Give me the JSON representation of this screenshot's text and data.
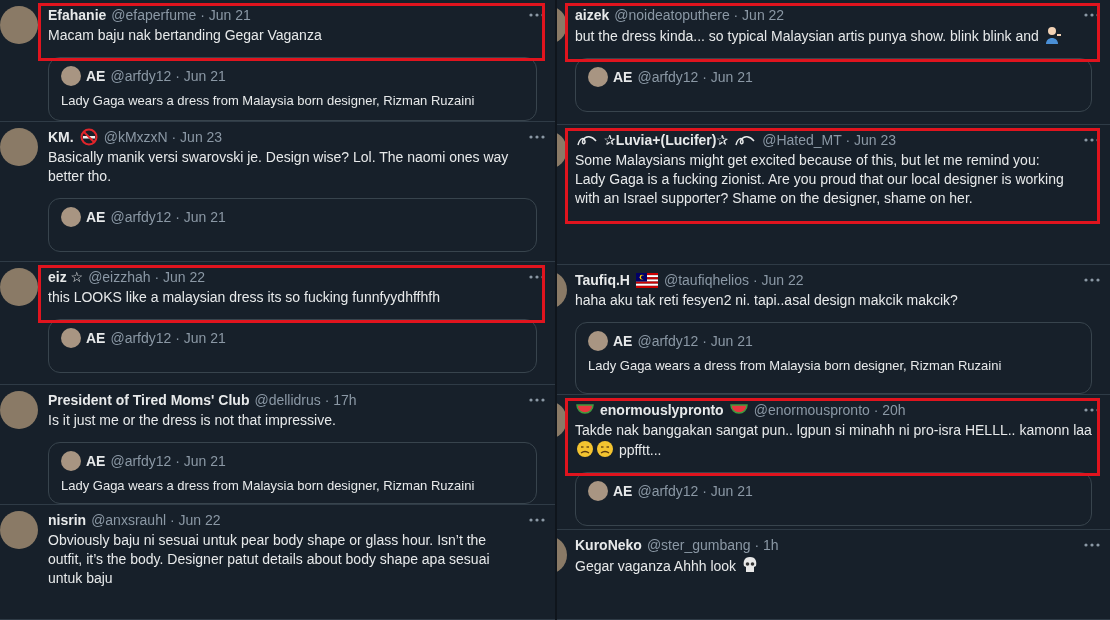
{
  "columns": [
    {
      "tweets": [
        {
          "name": [
            {
              "kind": "text",
              "text": "Efahanie"
            }
          ],
          "meta": "@efaperfume · Jun 21",
          "body": [
            {
              "kind": "text",
              "text": "Macam baju nak bertanding Gegar Vaganza"
            }
          ],
          "highlighted": true,
          "quote": {
            "name": "AE",
            "meta": "@arfdy12 · Jun 21",
            "text": "Lady Gaga wears a dress from Malaysia born designer, Rizman Ruzaini"
          }
        },
        {
          "name": [
            {
              "kind": "text",
              "text": "KM."
            },
            {
              "kind": "nosmoke"
            }
          ],
          "meta": "@kMxzxN · Jun 23",
          "body": [
            {
              "kind": "text",
              "text": "Basically manik versi swarovski je. Design wise? Lol. The naomi ones way better tho."
            }
          ],
          "highlighted": false,
          "quote": {
            "name": "AE",
            "meta": "@arfdy12 · Jun 21"
          }
        },
        {
          "name": [
            {
              "kind": "text",
              "text": "eiz ☆"
            }
          ],
          "meta": "@eizzhah · Jun 22",
          "body": [
            {
              "kind": "text",
              "text": "this LOOKS like a malaysian dress its so fucking funnfyydhffhfh"
            }
          ],
          "highlighted": true,
          "quote": {
            "name": "AE",
            "meta": "@arfdy12 · Jun 21"
          }
        },
        {
          "name": [
            {
              "kind": "text",
              "text": "President of Tired Moms' Club"
            }
          ],
          "meta": "@dellidrus · 17h",
          "body": [
            {
              "kind": "text",
              "text": "Is it just me or the dress is not that impressive."
            }
          ],
          "highlighted": false,
          "quote": {
            "name": "AE",
            "meta": "@arfdy12 · Jun 21",
            "text": "Lady Gaga wears a dress from Malaysia born designer, Rizman Ruzaini"
          }
        },
        {
          "name": [
            {
              "kind": "text",
              "text": "nisrin"
            }
          ],
          "meta": "@anxsrauhl · Jun 22",
          "body": [
            {
              "kind": "text",
              "text": "Obviously baju ni sesuai untuk pear body shape or glass hour. Isn’t the outfit, it’s the body. Designer patut details about body shape apa sesuai untuk baju"
            }
          ],
          "highlighted": false
        }
      ]
    },
    {
      "tweets": [
        {
          "name": [
            {
              "kind": "text",
              "text": "aizek"
            }
          ],
          "meta": "@noideatoputhere · Jun 22",
          "body": [
            {
              "kind": "text",
              "text": "but the dress kinda... so typical Malaysian artis punya show. blink blink and"
            },
            {
              "kind": "person"
            }
          ],
          "highlighted": true,
          "quote": {
            "name": "AE",
            "meta": "@arfdy12 · Jun 21"
          }
        },
        {
          "name": [
            {
              "kind": "swirl"
            },
            {
              "kind": "text",
              "text": "✰Luvia+(Lucifer)✰"
            },
            {
              "kind": "swirl"
            }
          ],
          "meta": "@Hated_MT · Jun 23",
          "body": [
            {
              "kind": "text",
              "text": "Some Malaysians might get excited because of this, but let me remind you: Lady Gaga is a fucking zionist. Are you proud that our local designer is working with an Israel supporter? Shame on the designer, shame on her."
            }
          ],
          "highlighted": true
        },
        {
          "name": [
            {
              "kind": "text",
              "text": "Taufiq.H"
            },
            {
              "kind": "flag"
            }
          ],
          "meta": "@taufiqhelios · Jun 22",
          "body": [
            {
              "kind": "text",
              "text": "haha aku tak reti fesyen2 ni. tapi..asal design makcik makcik?"
            }
          ],
          "highlighted": false,
          "quote": {
            "name": "AE",
            "meta": "@arfdy12 · Jun 21",
            "text": "Lady Gaga wears a dress from Malaysia born designer, Rizman Ruzaini"
          }
        },
        {
          "name": [
            {
              "kind": "melon"
            },
            {
              "kind": "text",
              "text": "enormouslypronto"
            },
            {
              "kind": "melon"
            }
          ],
          "meta": "@enormouspronto · 20h",
          "body": [
            {
              "kind": "text",
              "text": "Takde nak banggakan sangat pun.. lgpun si minahh ni pro-isra HELLL.."
            },
            {
              "kind": "text",
              "text": "kamonn laa"
            },
            {
              "kind": "face"
            },
            {
              "kind": "face"
            },
            {
              "kind": "text",
              "text": " ppfftt..."
            }
          ],
          "highlighted": true,
          "quote": {
            "name": "AE",
            "meta": "@arfdy12 · Jun 21"
          }
        },
        {
          "name": [
            {
              "kind": "text",
              "text": "KuroNeko"
            }
          ],
          "meta": "@ster_gumbang · 1h",
          "body": [
            {
              "kind": "text",
              "text": "Gegar vaganza Ahhh look"
            },
            {
              "kind": "skull"
            }
          ],
          "highlighted": false
        }
      ]
    }
  ]
}
